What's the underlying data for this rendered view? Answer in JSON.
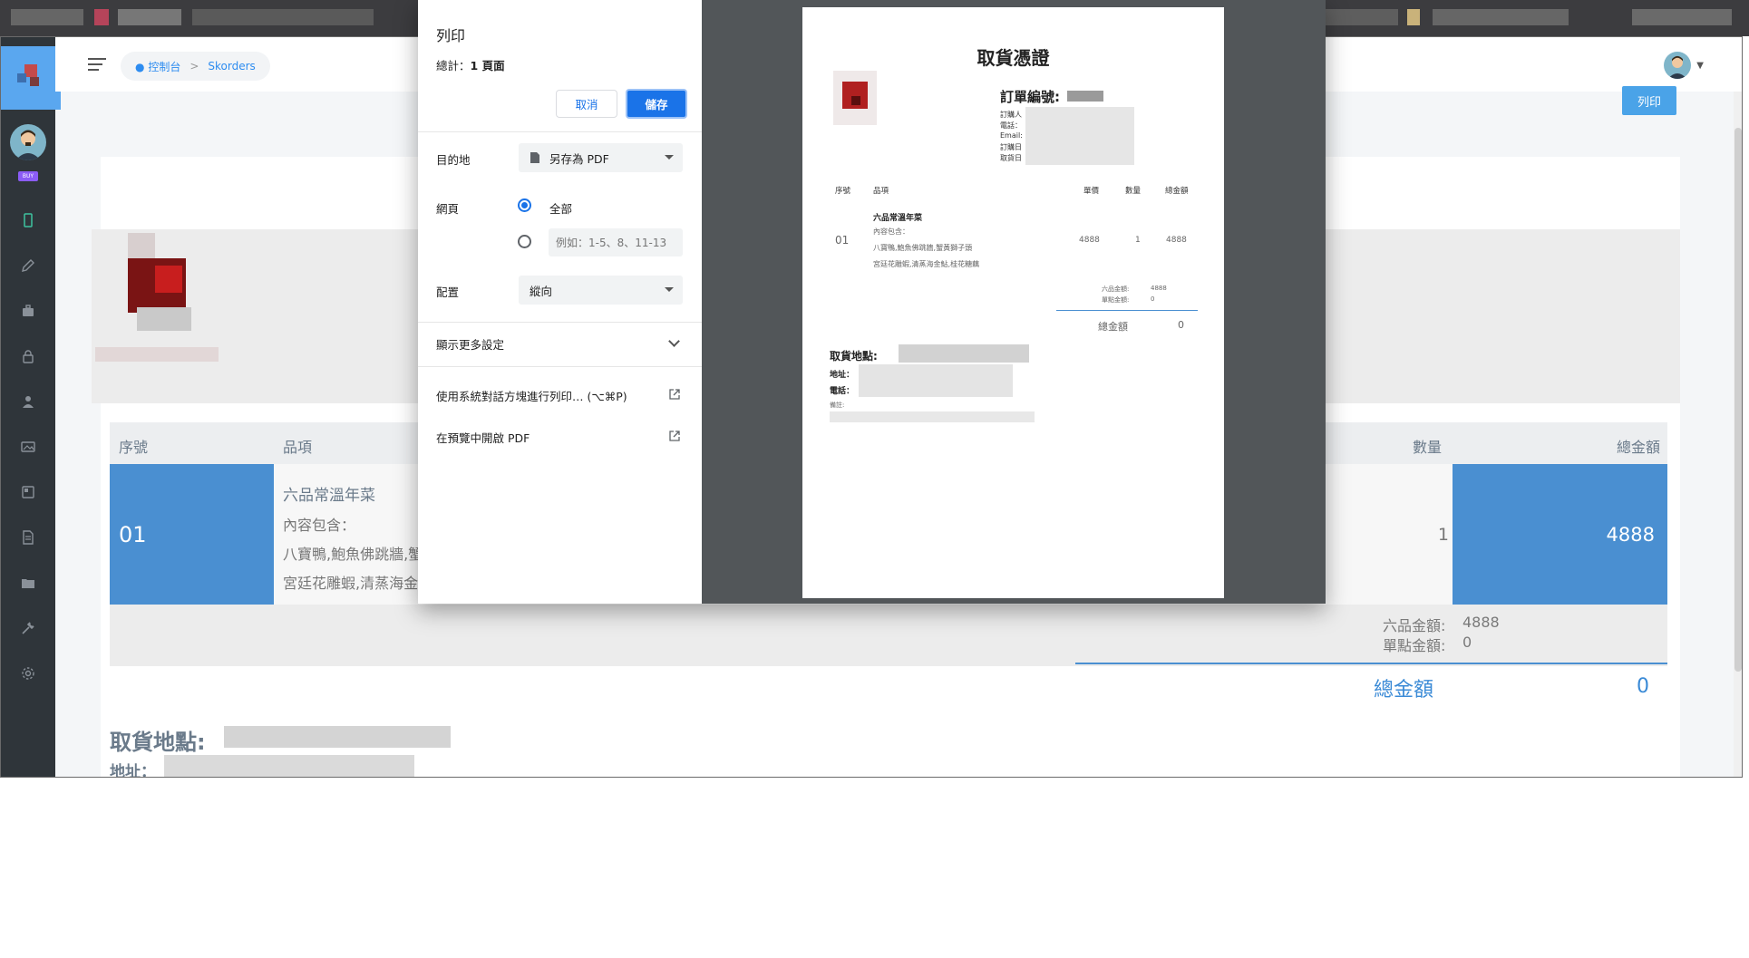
{
  "print_dialog": {
    "title": "列印",
    "total_label": "總計：",
    "total_value": "1 頁面",
    "cancel_label": "取消",
    "save_label": "儲存",
    "destination_label": "目的地",
    "destination_value": "另存為 PDF",
    "pages_label": "網頁",
    "pages_all_label": "全部",
    "pages_custom_placeholder": "例如：1-5、8、11-13",
    "layout_label": "配置",
    "layout_value": "縱向",
    "more_settings_label": "顯示更多設定",
    "system_dialog_label": "使用系統對話方塊進行列印… (⌥⌘P)",
    "open_preview_label": "在預覽中開啟 PDF"
  },
  "preview_page": {
    "title": "取貨憑證",
    "order_no_label": "訂單編號:",
    "buyer_label": "訂購人",
    "phone_label": "電話：",
    "email_label": "Email:",
    "order_date_label": "訂購日",
    "pickup_date_label": "取貨日",
    "headers": {
      "no": "序號",
      "item": "品項",
      "price": "單價",
      "qty": "數量",
      "total": "總金額"
    },
    "row": {
      "no": "01",
      "name": "六品常溫年菜",
      "content_label": "內容包含：",
      "line1": "八寶鴨,鮑魚佛跳牆,蟹黃獅子頭",
      "line2": "宮廷花雕蝦,清蒸海金鮎,桂花糖藕",
      "price": "4888",
      "qty": "1",
      "total": "4888"
    },
    "sub1_label": "六品金額:",
    "sub1_value": "4888",
    "sub2_label": "單點金額:",
    "sub2_value": "0",
    "grand_label": "總金額",
    "grand_value": "0",
    "pickup_label": "取貨地點:",
    "address_label": "地址：",
    "phone2_label": "電話：",
    "note_label": "備註:"
  },
  "app": {
    "breadcrumb_home": "控制台",
    "breadcrumb_sep": ">",
    "breadcrumb_current": "Skorders",
    "badge_text": "BUY",
    "print_button": "列印",
    "table_headers": {
      "no": "序號",
      "item": "品項",
      "qty": "數量",
      "total": "總金額"
    },
    "row": {
      "no": "01",
      "name": "六品常溫年菜",
      "content_label": "內容包含：",
      "line1": "八寶鴨,鮑魚佛跳牆,蟹",
      "line2": "宮廷花雕蝦,清蒸海金",
      "qty": "1",
      "total": "4888"
    },
    "sub1_label": "六品金額:",
    "sub1_value": "4888",
    "sub2_label": "單點金額:",
    "sub2_value": "0",
    "grand_label": "總金額",
    "grand_value": "0",
    "pickup_label": "取貨地點:",
    "address_label": "地址："
  },
  "colors": {
    "accent": "#1a73e8",
    "app_blue": "#4a8fd1",
    "sidebar": "#2f353a",
    "preview_bg": "#525659"
  }
}
